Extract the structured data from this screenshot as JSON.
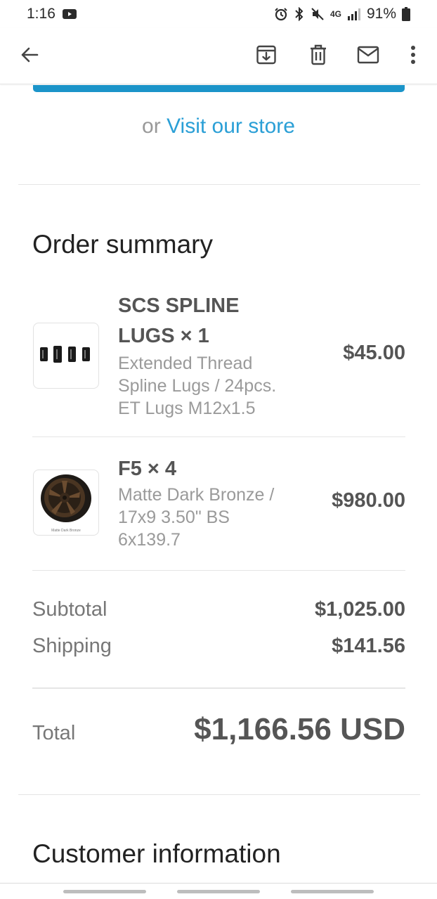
{
  "status_bar": {
    "time": "1:16",
    "battery": "91%",
    "icons": [
      "youtube-icon",
      "alarm-icon",
      "bluetooth-icon",
      "mute-icon",
      "lte-icon",
      "signal-icon",
      "battery-icon"
    ],
    "network": "4G"
  },
  "app_bar": {
    "icons": [
      "back-arrow-icon",
      "archive-icon",
      "trash-icon",
      "mail-icon",
      "more-vert-icon"
    ]
  },
  "cta": {
    "prefix": "or",
    "link_text": "Visit our store"
  },
  "order_summary": {
    "title": "Order summary",
    "items": [
      {
        "name_line1": "SCS SPLINE",
        "name_line2": "LUGS × 1",
        "desc_lines": [
          "Extended Thread",
          "Spline Lugs / 24pcs.",
          "ET Lugs M12x1.5"
        ],
        "price": "$45.00"
      },
      {
        "name_line1": "F5 × 4",
        "desc_lines": [
          "Matte Dark Bronze /",
          "17x9 3.50\" BS",
          "6x139.7"
        ],
        "price": "$980.00",
        "thumb_caption": "Matte Dark Bronze"
      }
    ],
    "subtotal_label": "Subtotal",
    "subtotal_value": "$1,025.00",
    "shipping_label": "Shipping",
    "shipping_value": "$141.56",
    "total_label": "Total",
    "total_value": "$1,166.56 USD"
  },
  "customer_information": {
    "title": "Customer information"
  },
  "colors": {
    "accent": "#2a9fd6",
    "cta_bar": "#1b94c9",
    "text_dark": "#222222",
    "text_mid": "#555555",
    "text_muted": "#9a9a9a"
  }
}
